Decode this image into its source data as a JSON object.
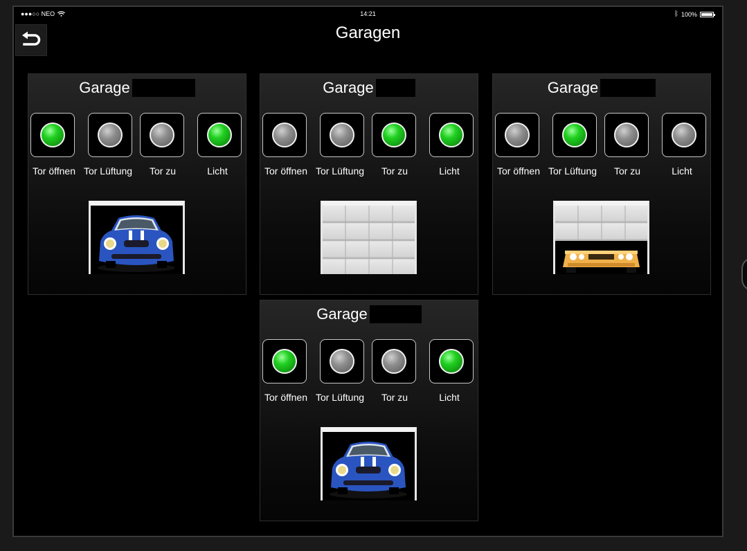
{
  "statusbar": {
    "carrier": "●●●○○ NEO",
    "time": "14:21",
    "battery": "100%",
    "battery_level": 1.0
  },
  "header": {
    "title": "Garagen",
    "back_icon": "back-arrow-icon"
  },
  "colors": {
    "lamp_on": "#20d020",
    "lamp_off": "#8d8d8d",
    "background": "#000000"
  },
  "garages": [
    {
      "title": "Garage",
      "door": {
        "state": "open",
        "car": "blue-mini"
      },
      "buttons": [
        {
          "label": "Tor öffnen",
          "lamp": "on"
        },
        {
          "label": "Tor Lüftung",
          "lamp": "off"
        },
        {
          "label": "Tor zu",
          "lamp": "off"
        },
        {
          "label": "Licht",
          "lamp": "on"
        }
      ]
    },
    {
      "title": "Garage",
      "door": {
        "state": "closed",
        "car": "none"
      },
      "buttons": [
        {
          "label": "Tor öffnen",
          "lamp": "off"
        },
        {
          "label": "Tor Lüftung",
          "lamp": "off"
        },
        {
          "label": "Tor zu",
          "lamp": "on"
        },
        {
          "label": "Licht",
          "lamp": "on"
        }
      ]
    },
    {
      "title": "Garage",
      "door": {
        "state": "ventilation",
        "car": "orange"
      },
      "buttons": [
        {
          "label": "Tor öffnen",
          "lamp": "off"
        },
        {
          "label": "Tor Lüftung",
          "lamp": "on"
        },
        {
          "label": "Tor zu",
          "lamp": "off"
        },
        {
          "label": "Licht",
          "lamp": "off"
        }
      ]
    },
    {
      "title": "Garage",
      "door": {
        "state": "open",
        "car": "blue-mini"
      },
      "buttons": [
        {
          "label": "Tor öffnen",
          "lamp": "on"
        },
        {
          "label": "Tor Lüftung",
          "lamp": "off"
        },
        {
          "label": "Tor zu",
          "lamp": "off"
        },
        {
          "label": "Licht",
          "lamp": "on"
        }
      ]
    }
  ]
}
